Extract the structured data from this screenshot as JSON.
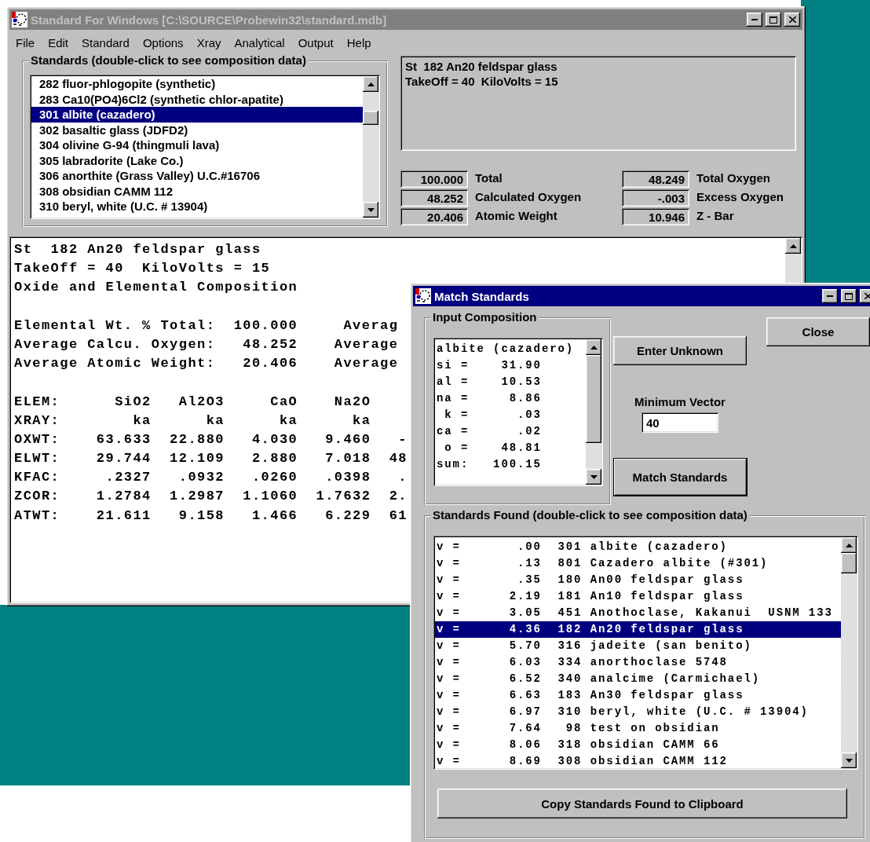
{
  "main_window": {
    "title": "Standard For Windows [C:\\SOURCE\\Probewin32\\standard.mdb]",
    "active": false,
    "menu": [
      "File",
      "Edit",
      "Standard",
      "Options",
      "Xray",
      "Analytical",
      "Output",
      "Help"
    ],
    "standards_group": {
      "title": "Standards (double-click to see composition data)",
      "items": [
        {
          "label": "282 fluor-phlogopite (synthetic)",
          "selected": false
        },
        {
          "label": "283 Ca10(PO4)6Cl2 (synthetic chlor-apatite)",
          "selected": false
        },
        {
          "label": "301 albite (cazadero)",
          "selected": true
        },
        {
          "label": "302 basaltic glass (JDFD2)",
          "selected": false
        },
        {
          "label": "304 olivine G-94 (thingmuli lava)",
          "selected": false
        },
        {
          "label": "305 labradorite (Lake Co.)",
          "selected": false
        },
        {
          "label": "306 anorthite (Grass Valley) U.C.#16706",
          "selected": false
        },
        {
          "label": "308 obsidian CAMM 112",
          "selected": false
        },
        {
          "label": "310 beryl, white (U.C. # 13904)",
          "selected": false
        }
      ]
    },
    "info_lines": [
      "St  182 An20 feldspar glass",
      "TakeOff = 40  KiloVolts = 15"
    ],
    "values_left": [
      {
        "value": "100.000",
        "label": "Total"
      },
      {
        "value": "48.252",
        "label": "Calculated Oxygen"
      },
      {
        "value": "20.406",
        "label": "Atomic Weight"
      }
    ],
    "values_right": [
      {
        "value": "48.249",
        "label": "Total Oxygen"
      },
      {
        "value": "-.003",
        "label": "Excess Oxygen"
      },
      {
        "value": "10.946",
        "label": "Z - Bar"
      }
    ],
    "report_blocks": [
      [
        "St  182 An20 feldspar glass",
        "TakeOff = 40  KiloVolts = 15",
        "Oxide and Elemental Composition"
      ],
      [
        "Elemental Wt. % Total:  100.000     Averag",
        "Average Calcu. Oxygen:   48.252    Average",
        "Average Atomic Weight:   20.406    Average"
      ],
      [
        "ELEM:      SiO2   Al2O3     CaO    Na2O",
        "XRAY:        ka      ka      ka      ka",
        "OXWT:    63.633  22.880   4.030   9.460   -",
        "ELWT:    29.744  12.109   2.880   7.018  48",
        "KFAC:     .2327   .0932   .0260   .0398   .",
        "ZCOR:    1.2784  1.2987  1.1060  1.7632  2.",
        "ATWT:    21.611   9.158   1.466   6.229  61"
      ]
    ]
  },
  "match_window": {
    "title": "Match Standards",
    "active": true,
    "input_group": {
      "title": "Input Composition",
      "lines": [
        "albite (cazadero)",
        "si =    31.90",
        "al =    10.53",
        "na =     8.86",
        " k =      .03",
        "ca =      .02",
        " o =    48.81",
        "sum:   100.15"
      ]
    },
    "enter_button": "Enter Unknown",
    "vector_label": "Minimum Vector",
    "vector_value": "40",
    "match_button": "Match Standards",
    "close_button": "Close",
    "found_group": {
      "title": "Standards Found (double-click to see composition data)",
      "rows": [
        {
          "prefix": "v =",
          "vector": ".00",
          "standard": "301 albite (cazadero)",
          "selected": false
        },
        {
          "prefix": "v =",
          "vector": ".13",
          "standard": "801 Cazadero albite (#301)",
          "selected": false
        },
        {
          "prefix": "v =",
          "vector": ".35",
          "standard": "180 An00 feldspar glass",
          "selected": false
        },
        {
          "prefix": "v =",
          "vector": "2.19",
          "standard": "181 An10 feldspar glass",
          "selected": false
        },
        {
          "prefix": "v =",
          "vector": "3.05",
          "standard": "451 Anothoclase, Kakanui  USNM 133",
          "selected": false
        },
        {
          "prefix": "v =",
          "vector": "4.36",
          "standard": "182 An20 feldspar glass",
          "selected": true
        },
        {
          "prefix": "v =",
          "vector": "5.70",
          "standard": "316 jadeite (san benito)",
          "selected": false
        },
        {
          "prefix": "v =",
          "vector": "6.03",
          "standard": "334 anorthoclase 5748",
          "selected": false
        },
        {
          "prefix": "v =",
          "vector": "6.52",
          "standard": "340 analcime (Carmichael)",
          "selected": false
        },
        {
          "prefix": "v =",
          "vector": "6.63",
          "standard": "183 An30 feldspar glass",
          "selected": false
        },
        {
          "prefix": "v =",
          "vector": "6.97",
          "standard": "310 beryl, white (U.C. # 13904)",
          "selected": false
        },
        {
          "prefix": "v =",
          "vector": "7.64",
          "standard": " 98 test on obsidian",
          "selected": false
        },
        {
          "prefix": "v =",
          "vector": "8.06",
          "standard": "318 obsidian CAMM 66",
          "selected": false
        },
        {
          "prefix": "v =",
          "vector": "8.69",
          "standard": "308 obsidian CAMM 112",
          "selected": false
        }
      ]
    },
    "copy_button": "Copy Standards Found to Clipboard"
  }
}
